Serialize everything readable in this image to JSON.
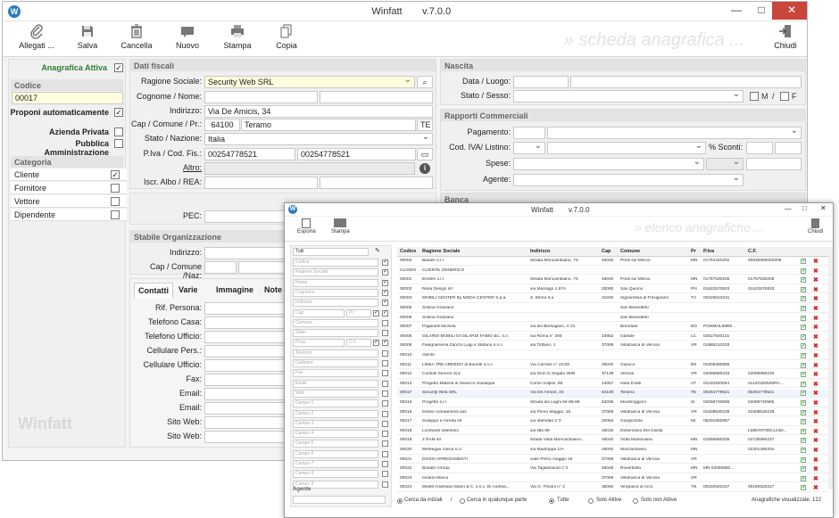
{
  "main_window": {
    "title": "Winfatt",
    "version": "v.7.0.0",
    "watermark": "» scheda anagrafica ...",
    "toolbar": {
      "allegati": "Allegati ...",
      "salva": "Salva",
      "cancella": "Cancella",
      "nuovo": "Nuovo",
      "stampa": "Stampa",
      "copia": "Copia",
      "chiudi": "Chiudi"
    },
    "left": {
      "anagrafica_attiva": "Anagrafica Attiva",
      "codice_header": "Codice",
      "codice_value": "00017",
      "proponi": "Proponi automaticamente",
      "azienda_privata": "Azienda Privata",
      "pubblica_amministrazione": "Pubblica Amministrazione",
      "categoria_header": "Categoria",
      "categorie": [
        "Cliente",
        "Fornitore",
        "Vettore",
        "Dipendente"
      ],
      "categorie_checked": [
        true,
        false,
        false,
        false
      ],
      "logo": "Winfatt"
    },
    "dati_fiscali": {
      "header": "Dati fiscali",
      "ragione_sociale_label": "Ragione Sociale:",
      "ragione_sociale": "Security Web SRL",
      "cognome_nome_label": "Cognome / Nome:",
      "indirizzo_label": "Indirizzo:",
      "indirizzo": "Via De Amicis, 34",
      "cap_label": "Cap / Comune / Pr.:",
      "cap": "64100",
      "comune": "Teramo",
      "provincia": "TE",
      "stato_label": "Stato / Nazione:",
      "stato": "Italia",
      "piva_label": "P.Iva / Cod. Fis.:",
      "piva": "00254778521",
      "codfis": "00254778521",
      "altro_label": "Altro:",
      "iscr_label": "Iscr. Albo / REA:",
      "pec_label": "PEC:"
    },
    "stabile": {
      "header": "Stabile Organizzazione",
      "indirizzo_label": "Indirizzo:",
      "cap_label": "Cap / Comune /Naz:"
    },
    "contatti": {
      "tabs": [
        "Contatti",
        "Varie",
        "Immagine",
        "Note"
      ],
      "fields": [
        "Rif. Persona:",
        "Telefono Casa:",
        "Telefono Ufficio:",
        "Cellulare Pers.:",
        "Cellulare Ufficio:",
        "Fax:",
        "Email:",
        "Email:",
        "Sito Web:",
        "Sito Web:"
      ]
    },
    "nascita": {
      "header": "Nascita",
      "data_label": "Data / Luogo:",
      "stato_label": "Stato / Sesso:",
      "m": "M",
      "f": "F"
    },
    "rapporti": {
      "header": "Rapporti Commerciali",
      "pagamento_label": "Pagamento:",
      "codiva_label": "Cod. IVA/ Listino:",
      "sconti_label": "% Sconti:",
      "spese_label": "Spese:",
      "agente_label": "Agente:"
    },
    "banca": {
      "header": "Banca"
    }
  },
  "list_window": {
    "title": "Winfatt",
    "version": "v.7.0.0",
    "watermark": "» elenco anagrafiche ...",
    "toolbar": {
      "esporta": "Esporta",
      "stampa": "Stampa",
      "chiudi": "Chiudi"
    },
    "filter": {
      "tutti": "Tutti",
      "fields": [
        "Codice",
        "Ragione Sociale",
        "Nome",
        "Cognome",
        "Indirizzo",
        "Cap",
        "Comune",
        "Stato",
        "P.Iva",
        "Telefono",
        "Cellulare",
        "Fax",
        "Email",
        "Web",
        "Campo 1",
        "Campo 2",
        "Campo 3",
        "Campo 4",
        "Campo 5",
        "Campo 6",
        "Campo 7",
        "Campo 8",
        "Campo 9"
      ],
      "pr": "Pr",
      "cf": "C.F.",
      "agente": "Agente"
    },
    "columns": [
      "Codice",
      "Ragione Sociale",
      "Indirizzo",
      "Cap",
      "Comune",
      "Pr",
      "P.Iva",
      "C.F."
    ],
    "rows": [
      [
        "00003",
        "Baulen s.r.l",
        "Strada Moncambiano, 73",
        "46040",
        "Ponti sul Mincio",
        "MN",
        "01764420202",
        "00635950020208"
      ],
      [
        "CLIGEN",
        "CLIENTE GENERICO",
        "",
        "",
        "",
        "",
        "",
        ""
      ],
      [
        "00001",
        "Erolten s.r.l",
        "Strada Moncambiano, 73",
        "46040",
        "Ponti sul Mincio",
        "MN",
        "01767530205",
        "01767530205"
      ],
      [
        "00002",
        "Resa Design srl",
        "via Marriago n.57A",
        "33080",
        "San Quirino",
        "PN",
        "01622570833",
        "01622570833"
      ],
      [
        "00004",
        "MOBILI CENTER By MODA CENTER S.p.a.",
        "S. Elena 3.a",
        "31040",
        "Signoressa di Trevignano",
        "TV",
        "00226510231",
        ""
      ],
      [
        "00005",
        "Solima Graziano",
        "",
        "",
        "San Benedetto",
        "",
        "",
        ""
      ],
      [
        "00006",
        "Solima Graziano",
        "",
        "",
        "San Benedetto",
        "",
        "",
        ""
      ],
      [
        "00007",
        "Paganelli Michela",
        "via dei Bersaglieri, n°21",
        "",
        "Brendate",
        "BG",
        "PGNMHL89R8...",
        ""
      ],
      [
        "00008",
        "GILARDI MOBILI DI GILARDI FABIO &C. s.n.",
        "via Roma n° 266",
        "23852",
        "Garlate",
        "LC",
        "02527640131",
        ""
      ],
      [
        "00009",
        "Falegnameria Zanchi Luigi e Stefano s.n.c.",
        "via Toffano, 1",
        "37069",
        "Villafranca di Verona",
        "VR",
        "01986210233",
        ""
      ],
      [
        "00010",
        "cliente",
        "",
        "",
        "",
        "",
        "",
        ""
      ],
      [
        "00011",
        "LINEA TRE ARREDO di Bonetti s.n.c.",
        "Via Carolve n° 21/29",
        "25040",
        "Gianico",
        "BS",
        "01808350985",
        ""
      ],
      [
        "00012",
        "Cordioli Service Snc",
        "via Dom G.Segala 29/B",
        "37139",
        "Verona",
        "VR",
        "04086880233",
        "04086880233"
      ],
      [
        "00013",
        "Progetto Materia di Saracco Giuseppe",
        "Corso Volpini, 85",
        "14057",
        "Isola D'asti",
        "AT",
        "01120320054",
        "01120320545RC..."
      ],
      [
        "00017",
        "Security Web SRL",
        "Via De Amicis, 34",
        "64100",
        "Teramo",
        "TE",
        "00254778521",
        "00254778521"
      ],
      [
        "00015",
        "Progetto s.r.l",
        "Strada dei Laghi 84-86-88",
        "53035",
        "Monteriggioni",
        "SI",
        "02086740565",
        "02086740565"
      ],
      [
        "00016",
        "Dosso Arredamenti sas",
        "via Primo Maggio, 15",
        "37069",
        "Villafranca di Verona",
        "VR",
        "01608530239",
        "01608530239"
      ],
      [
        "00017",
        "Sviluppo e Arreda srl",
        "via obendan n°2",
        "20084",
        "Gorgonzola",
        "MI",
        "05291650967",
        ""
      ],
      [
        "00018",
        "Lombardi Valentino",
        "via litta 68",
        "25015",
        "Desenzano Del Garda",
        "",
        "",
        "LMBVNT08C124D..."
      ],
      [
        "00019",
        "2 RAM srl",
        "strada Volta Moncambiano...",
        "46040",
        "Volta Mantovana",
        "MN",
        "01658880206",
        "02735990237"
      ],
      [
        "00020",
        "Mefeegan carica s.r.l",
        "via Madroppa 1/A",
        "46040",
        "Monzambano",
        "MN",
        "",
        "02301480204"
      ],
      [
        "00021",
        "DOSSI ARREDAMENTI",
        "viale Primo maggio 15",
        "37069",
        "Villafranca di Verona",
        "VR",
        "",
        ""
      ],
      [
        "00022",
        "Bonato Arreda",
        "Via Tagliamento n°2",
        "46048",
        "Roverbella",
        "MN",
        "MN 02000850...",
        ""
      ],
      [
        "00023",
        "Ionardi Marco",
        "",
        "37069",
        "Villafranca di Verona",
        "VR",
        "",
        ""
      ],
      [
        "00024",
        "Molett Andreaso Mario & C. s.n.c. Di Andrea...",
        "Via G. Frisoni n° 2",
        "38092",
        "Vergnano di Arco",
        "TN",
        "00160520227",
        "00160520227"
      ]
    ],
    "footer": {
      "cerca_iniziali": "Cerca da iniziali",
      "cerca_qualunque": "Cerca in qualunque parte",
      "tutte": "Tutte",
      "solo_attive": "Solo Attive",
      "solo_non_attive": "Solo non Attive",
      "visualizzate": "Anagrafiche visualizzate: 122"
    }
  },
  "colors": {
    "accent": "#2b79c2",
    "close": "#c9463d",
    "active_green": "#2e7d32",
    "highlight": "#ffffe0"
  }
}
